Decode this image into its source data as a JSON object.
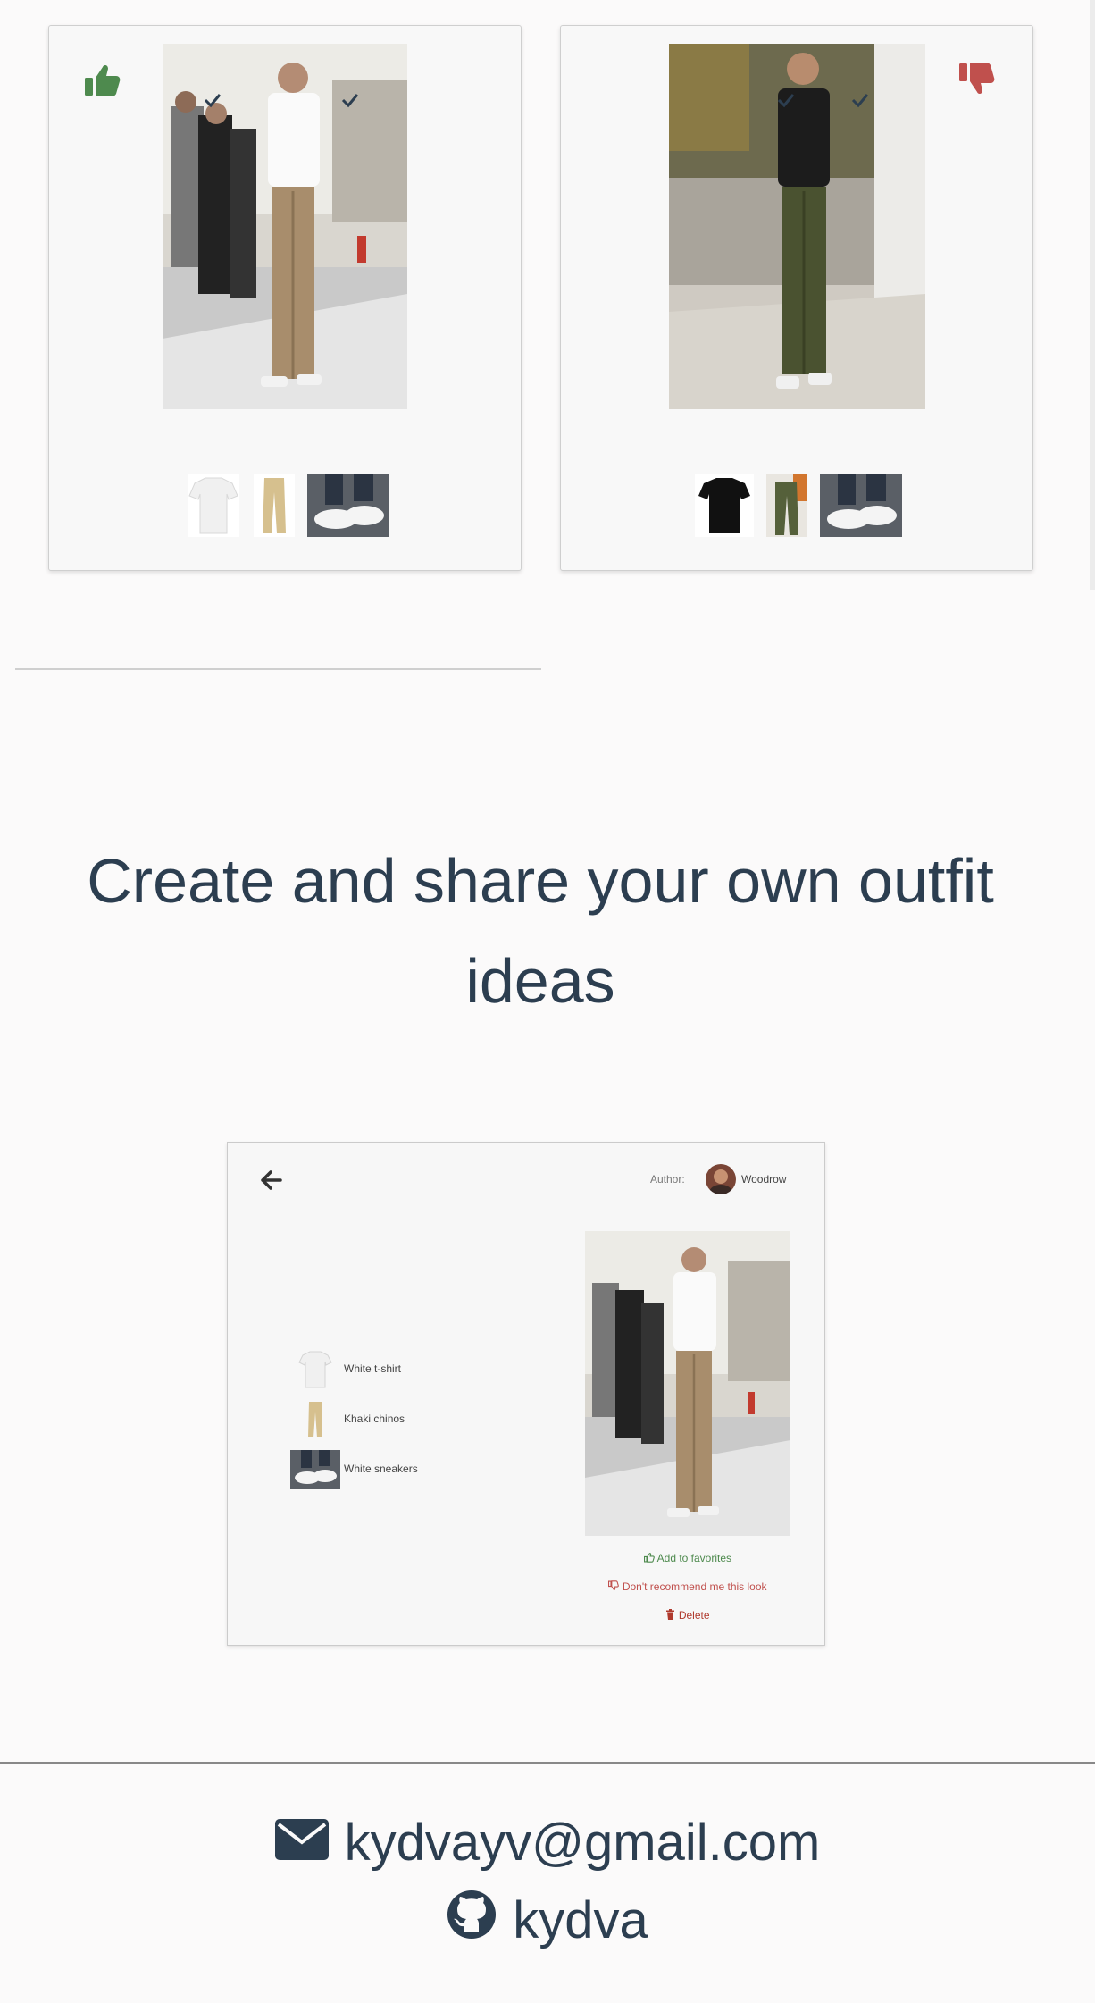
{
  "outfits": [
    {
      "reaction": "thumbs-up",
      "reaction_color": "#4e8a4e",
      "items": [
        {
          "name": "white t-shirt",
          "checked": true
        },
        {
          "name": "khaki chinos",
          "checked": false
        },
        {
          "name": "white sneakers",
          "checked": true
        }
      ]
    },
    {
      "reaction": "thumbs-down",
      "reaction_color": "#c0504d",
      "items": [
        {
          "name": "black t-shirt",
          "checked": false
        },
        {
          "name": "olive cargo pants",
          "checked": true
        },
        {
          "name": "white sneakers",
          "checked": true
        }
      ]
    }
  ],
  "section": {
    "headline": "Create and share your own outfit ideas"
  },
  "preview": {
    "author_label": "Author:",
    "author_name": "Woodrow",
    "items": [
      "White t-shirt",
      "Khaki chinos",
      "White sneakers"
    ],
    "add_favorites": "Add to favorites",
    "dont_recommend": "Don't recommend me this look",
    "delete": "Delete"
  },
  "footer": {
    "email": "kydvayv@gmail.com",
    "github": "kydva"
  },
  "colors": {
    "text": "#2c3e50",
    "like": "#4e8a4e",
    "dislike": "#c0504d",
    "delete": "#b03a2e"
  }
}
